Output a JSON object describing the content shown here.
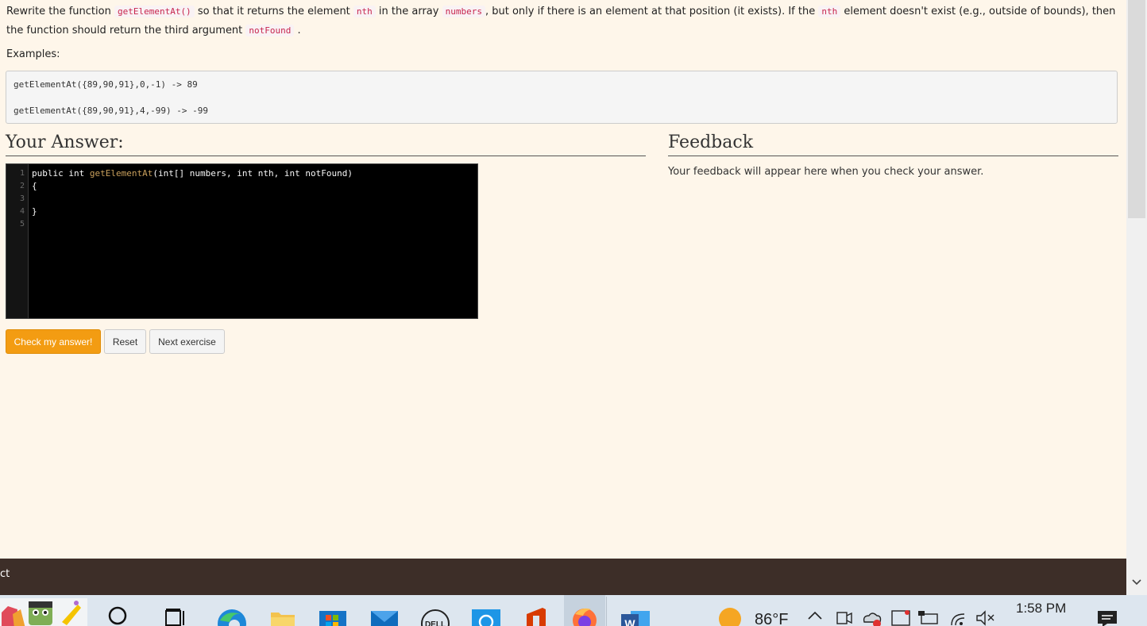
{
  "prompt": {
    "p1": "Rewrite the function ",
    "c1": "getElementAt()",
    "p2": " so that it returns the element ",
    "c2": "nth",
    "p3": " in the array ",
    "c3": "numbers",
    "p4": ", but only if there is an element at that position (it exists). If the ",
    "c4": "nth",
    "p5": " element doesn't exist (e.g., outside of bounds), then the function should return the third argument ",
    "c5": "notFound",
    "p6": " ."
  },
  "examples": {
    "label": "Examples:",
    "lines": [
      "getElementAt({89,90,91},0,-1) -> 89",
      "getElementAt({89,90,91},4,-99) -> -99"
    ]
  },
  "answer": {
    "heading": "Your Answer:",
    "line_numbers": [
      "1",
      "2",
      "3",
      "4",
      "5"
    ],
    "code": {
      "l1_a": "public int ",
      "l1_fn": "getElementAt",
      "l1_b": "(int[] numbers, int nth, int notFound)",
      "l2": "{",
      "l3": "",
      "l4": "}",
      "l5": ""
    }
  },
  "feedback": {
    "heading": "Feedback",
    "text": "Your feedback will appear here when you check your answer."
  },
  "buttons": {
    "check": "Check my answer!",
    "reset": "Reset",
    "next": "Next exercise"
  },
  "footer": {
    "text": "ct"
  },
  "taskbar": {
    "weather": "86°F",
    "time": "1:58 PM",
    "icons": [
      "app-stack-icon",
      "search-icon",
      "task-view-icon",
      "edge-icon",
      "file-explorer-icon",
      "store-icon",
      "mail-icon",
      "dell-icon",
      "cortana-icon",
      "office-icon",
      "firefox-icon",
      "word-icon",
      "weather-sun-icon",
      "chevron-up-icon",
      "meet-icon",
      "onedrive-icon",
      "display-icon",
      "battery-icon",
      "wifi-icon",
      "volume-mute-icon",
      "notification-icon"
    ],
    "colors": {
      "taskbar": "#dde6ef",
      "edge": "#1e88d8",
      "store": "#1573c6",
      "mail": "#0f6cbd",
      "office": "#d83b01",
      "firefox": "#ff7139",
      "word": "#2b579a",
      "sun": "#f5a623"
    }
  },
  "colors": {
    "page_bg": "#fef6ea",
    "primary_button": "#f39c12",
    "footer_bg": "#3d2e28",
    "editor_bg": "#000000",
    "inline_code": "#c7254e"
  }
}
